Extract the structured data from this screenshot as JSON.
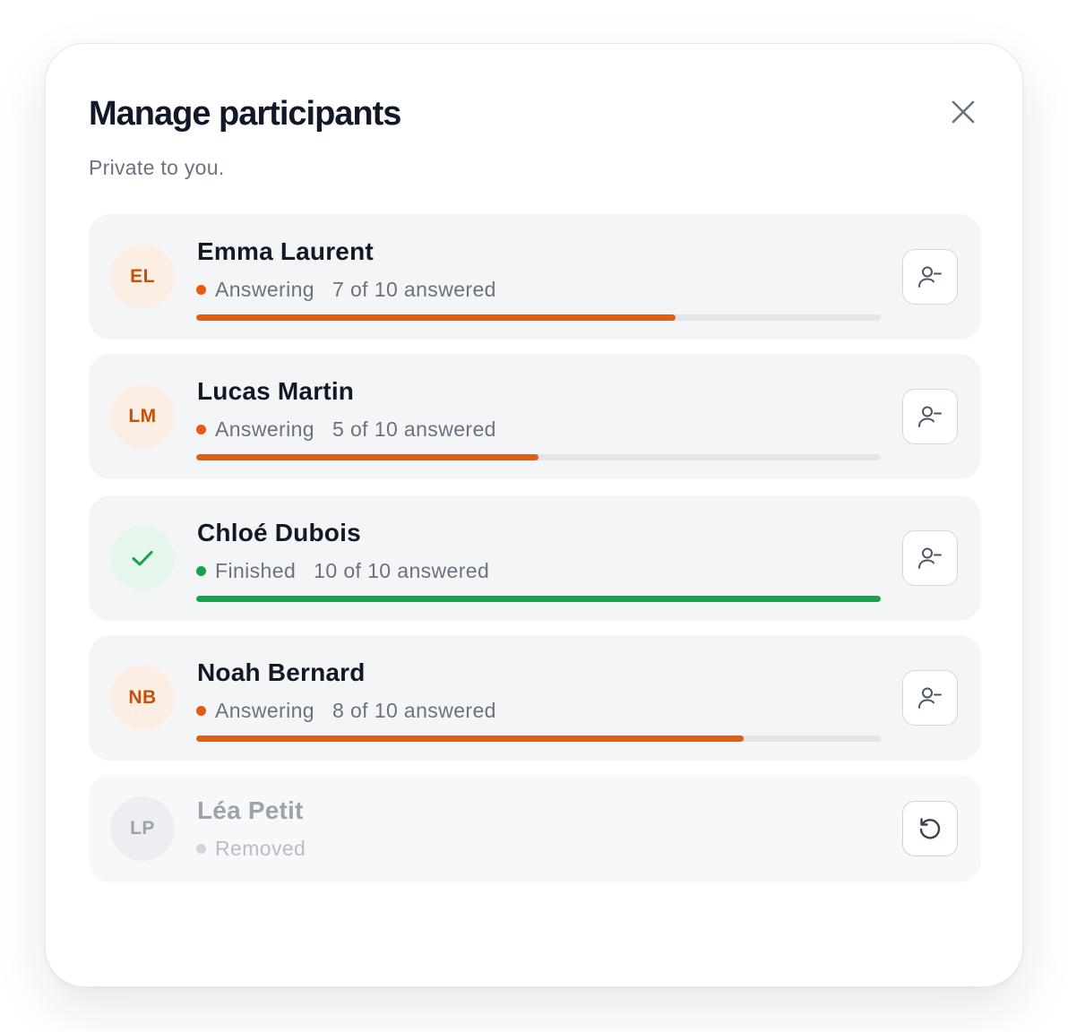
{
  "dialog": {
    "title": "Manage participants",
    "subtitle": "Private to you."
  },
  "icons": {
    "close": "close-icon",
    "remove": "user-minus-icon",
    "restore": "restore-icon",
    "finished": "check-icon"
  },
  "colors": {
    "accent_orange": "#e35d10",
    "finished_green": "#16a34a",
    "track": "#e3e5e8",
    "removed_grey": "#9ca3af"
  },
  "participants": [
    {
      "initials": "EL",
      "name": "Emma Laurent",
      "status": "Answering",
      "progress_text": "7 of 10 answered",
      "answered": 7,
      "total": 10
    },
    {
      "initials": "LM",
      "name": "Lucas Martin",
      "status": "Answering",
      "progress_text": "5 of 10 answered",
      "answered": 5,
      "total": 10
    },
    {
      "initials": "",
      "name": "Chloé Dubois",
      "status": "Finished",
      "progress_text": "10 of 10 answered",
      "answered": 10,
      "total": 10
    },
    {
      "initials": "NB",
      "name": "Noah Bernard",
      "status": "Answering",
      "progress_text": "8 of 10 answered",
      "answered": 8,
      "total": 10
    },
    {
      "initials": "LP",
      "name": "Léa Petit",
      "status": "Removed"
    }
  ]
}
